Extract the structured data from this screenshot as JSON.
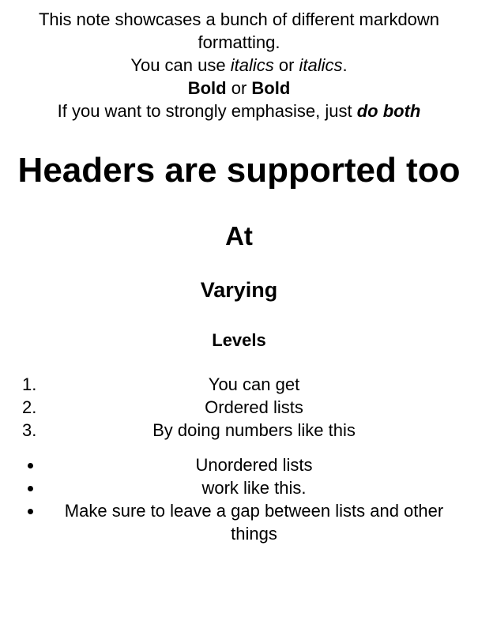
{
  "intro": {
    "line1": "This note showcases a bunch of different markdown formatting.",
    "line2_prefix": "You can use ",
    "line2_italic_a": "italics",
    "line2_or": " or ",
    "line2_italic_b": "italics",
    "line2_suffix": ".",
    "line3_bold_a": "Bold",
    "line3_or": " or ",
    "line3_bold_b": "Bold",
    "line4_prefix": "If you want to strongly emphasise, just ",
    "line4_bold_italic": "do both"
  },
  "headings": {
    "h1": "Headers are supported too",
    "h2": "At",
    "h3": "Varying",
    "h4": "Levels"
  },
  "ordered_list": [
    {
      "marker": "1.",
      "text": "You can get"
    },
    {
      "marker": "2.",
      "text": "Ordered lists"
    },
    {
      "marker": "3.",
      "text": "By doing numbers like this"
    }
  ],
  "unordered_list": [
    {
      "text": "Unordered lists"
    },
    {
      "text": "work like this."
    },
    {
      "text": "Make sure to leave a gap between lists and other things"
    }
  ]
}
